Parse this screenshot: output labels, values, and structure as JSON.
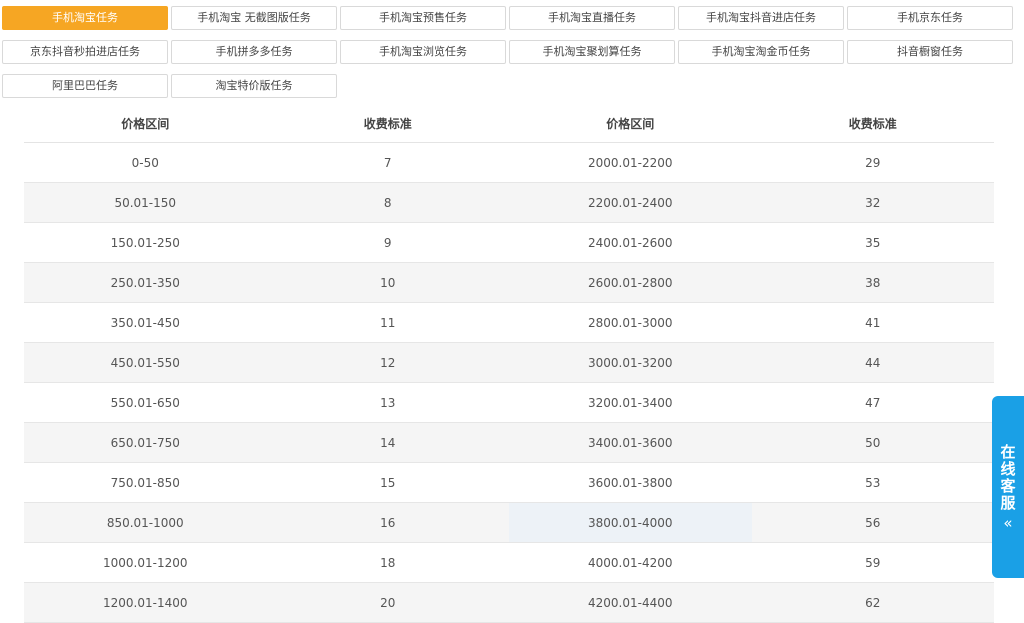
{
  "tabs": [
    {
      "label": "手机淘宝任务",
      "active": true
    },
    {
      "label": "手机淘宝 无截图版任务",
      "active": false
    },
    {
      "label": "手机淘宝预售任务",
      "active": false
    },
    {
      "label": "手机淘宝直播任务",
      "active": false
    },
    {
      "label": "手机淘宝抖音进店任务",
      "active": false
    },
    {
      "label": "手机京东任务",
      "active": false
    },
    {
      "label": "京东抖音秒拍进店任务",
      "active": false
    },
    {
      "label": "手机拼多多任务",
      "active": false
    },
    {
      "label": "手机淘宝浏览任务",
      "active": false
    },
    {
      "label": "手机淘宝聚划算任务",
      "active": false
    },
    {
      "label": "手机淘宝淘金币任务",
      "active": false
    },
    {
      "label": "抖音橱窗任务",
      "active": false
    },
    {
      "label": "阿里巴巴任务",
      "active": false
    },
    {
      "label": "淘宝特价版任务",
      "active": false
    }
  ],
  "table": {
    "headers": [
      "价格区间",
      "收费标准",
      "价格区间",
      "收费标准"
    ],
    "rows": [
      [
        "0-50",
        "7",
        "2000.01-2200",
        "29"
      ],
      [
        "50.01-150",
        "8",
        "2200.01-2400",
        "32"
      ],
      [
        "150.01-250",
        "9",
        "2400.01-2600",
        "35"
      ],
      [
        "250.01-350",
        "10",
        "2600.01-2800",
        "38"
      ],
      [
        "350.01-450",
        "11",
        "2800.01-3000",
        "41"
      ],
      [
        "450.01-550",
        "12",
        "3000.01-3200",
        "44"
      ],
      [
        "550.01-650",
        "13",
        "3200.01-3400",
        "47"
      ],
      [
        "650.01-750",
        "14",
        "3400.01-3600",
        "50"
      ],
      [
        "750.01-850",
        "15",
        "3600.01-3800",
        "53"
      ],
      [
        "850.01-1000",
        "16",
        "3800.01-4000",
        "56"
      ],
      [
        "1000.01-1200",
        "18",
        "4000.01-4200",
        "59"
      ],
      [
        "1200.01-1400",
        "20",
        "4200.01-4400",
        "62"
      ]
    ]
  },
  "customer_service": {
    "chars": [
      "在",
      "线",
      "客",
      "服"
    ],
    "arrow": "«"
  },
  "colors": {
    "accent": "#f6a623",
    "widget": "#1aa0e6"
  }
}
